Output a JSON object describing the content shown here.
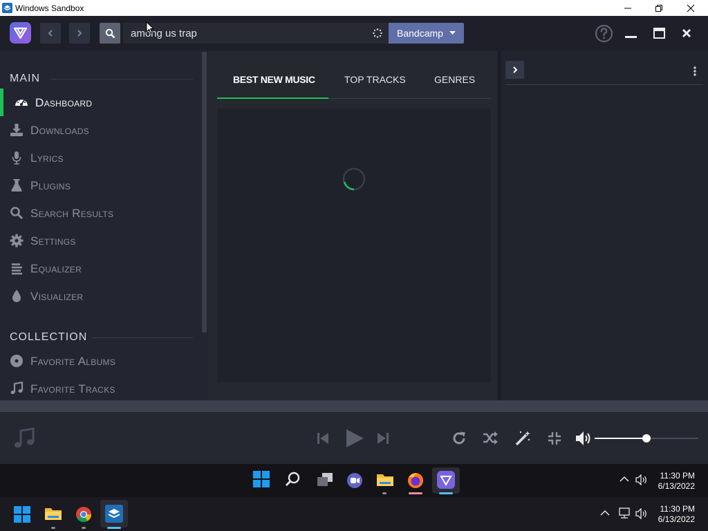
{
  "host": {
    "title": "Windows Sandbox"
  },
  "search": {
    "query": "among us trap",
    "provider": "Bandcamp"
  },
  "sidebar": {
    "main_header": "MAIN",
    "collection_header": "COLLECTION",
    "main_items": [
      {
        "label": "Dashboard",
        "icon": "dashboard-icon",
        "active": true
      },
      {
        "label": "Downloads",
        "icon": "download-icon"
      },
      {
        "label": "Lyrics",
        "icon": "microphone-icon"
      },
      {
        "label": "Plugins",
        "icon": "flask-icon"
      },
      {
        "label": "Search Results",
        "icon": "search-icon"
      },
      {
        "label": "Settings",
        "icon": "gear-icon"
      },
      {
        "label": "Equalizer",
        "icon": "equalizer-icon"
      },
      {
        "label": "Visualizer",
        "icon": "droplet-icon"
      }
    ],
    "collection_items": [
      {
        "label": "Favorite Albums",
        "icon": "disc-icon"
      },
      {
        "label": "Favorite Tracks",
        "icon": "music-note-icon"
      }
    ]
  },
  "tabs": [
    "BEST NEW MUSIC",
    "TOP TRACKS",
    "GENRES"
  ],
  "player": {
    "volume": 0.5
  },
  "taskbar": {
    "clock_upper_time": "11:30 PM",
    "clock_upper_date": "6/13/2022",
    "clock_lower_time": "11:30 PM",
    "clock_lower_date": "6/13/2022"
  },
  "colors": {
    "accent": "#1ec05a",
    "provider": "#5f6fa8"
  }
}
